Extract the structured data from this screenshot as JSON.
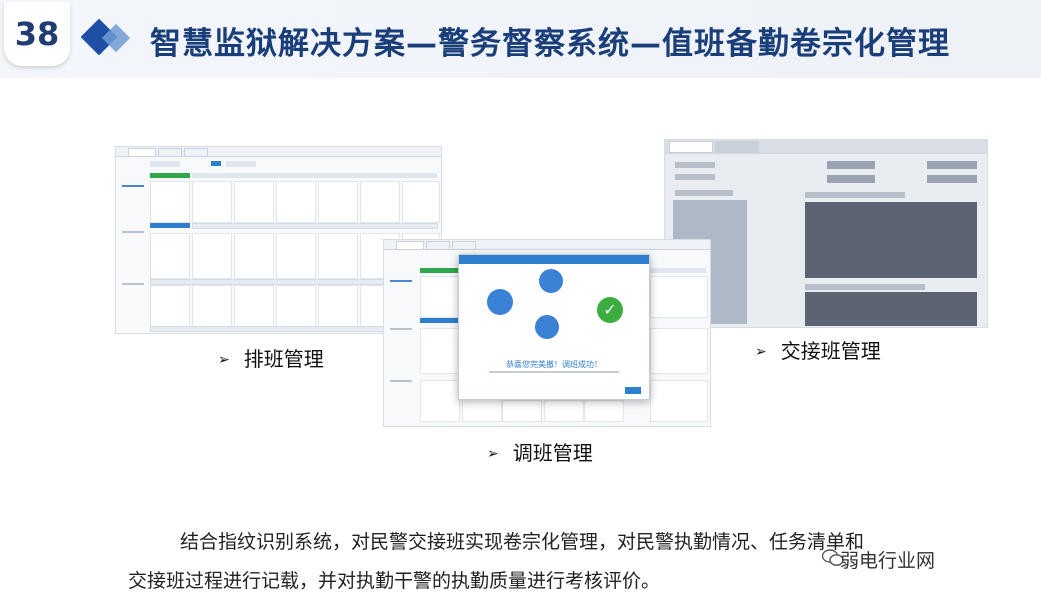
{
  "header": {
    "slide_number": "38",
    "title": "智慧监狱解决方案—警务督察系统—值班备勤卷宗化管理"
  },
  "captions": {
    "scheduling": "排班管理",
    "handover": "交接班管理",
    "shift_change": "调班管理"
  },
  "dialog": {
    "success_text": "恭喜您完美撤！调班成功！"
  },
  "paragraph": {
    "line1": "结合指纹识别系统，对民警交接班实现卷宗化管理，对民警执勤情况、任务清单和",
    "line2": "交接班过程进行记载，并对执勤干警的执勤质量进行考核评价。"
  },
  "watermark": {
    "text": "弱电行业网"
  },
  "colors": {
    "title": "#1a3e7a",
    "accent_blue": "#2f7fd0",
    "accent_green": "#2ea84a",
    "panel_gray": "#5c6473"
  }
}
